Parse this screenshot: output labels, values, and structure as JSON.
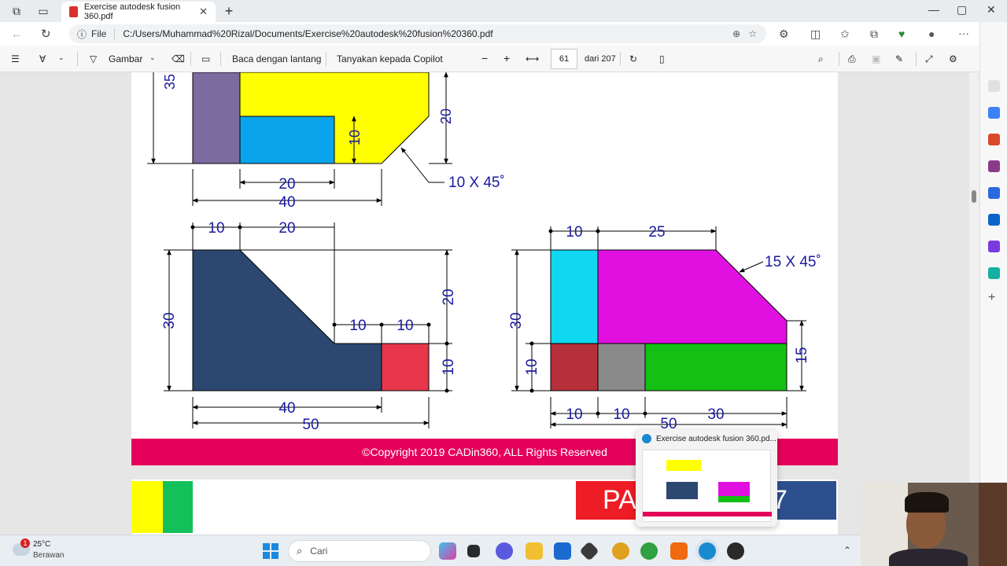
{
  "browser": {
    "tab_title": "Exercise autodesk fusion 360.pdf",
    "address_prefix": "File",
    "url": "C:/Users/Muhammad%20Rizal/Documents/Exercise%20autodesk%20fusion%20360.pdf"
  },
  "pdf_toolbar": {
    "draw_label": "Gambar",
    "read_aloud_label": "Baca dengan lantang",
    "copilot_label": "Tanyakan kepada Copilot",
    "current_page": "61",
    "total_pages_label": "dari 207"
  },
  "document": {
    "copyright": "©Copyright 2019 CADin360, ALL Rights Reserved",
    "next_page_banner": "PA",
    "next_page_banner_tail": "7",
    "drawing1": {
      "dims": [
        "35",
        "20",
        "10",
        "20",
        "40"
      ],
      "chamfer": "10 X 45˚"
    },
    "drawing2": {
      "dims": [
        "10",
        "20",
        "30",
        "20",
        "10",
        "10",
        "10",
        "40",
        "50"
      ]
    },
    "drawing3": {
      "dims": [
        "10",
        "25",
        "30",
        "10",
        "15",
        "10",
        "10",
        "50",
        "30"
      ],
      "chamfer": "15 X 45˚"
    }
  },
  "preview": {
    "title": "Exercise autodesk fusion 360.pd..."
  },
  "taskbar": {
    "weather_temp": "25°C",
    "weather_desc": "Berawan",
    "weather_badge": "1",
    "search_placeholder": "Cari"
  },
  "colors": {
    "purple": "#7b6b9e",
    "yellow": "#ffff00",
    "blue": "#0aa4ec",
    "navy": "#2c4770",
    "red": "#e8374a",
    "cyan": "#10d8f0",
    "magenta": "#e010e0",
    "darkred": "#b5303a",
    "gray": "#8a8a8a",
    "green": "#14c014",
    "dim": "#1a1aa0",
    "banner": "#e5005c"
  }
}
